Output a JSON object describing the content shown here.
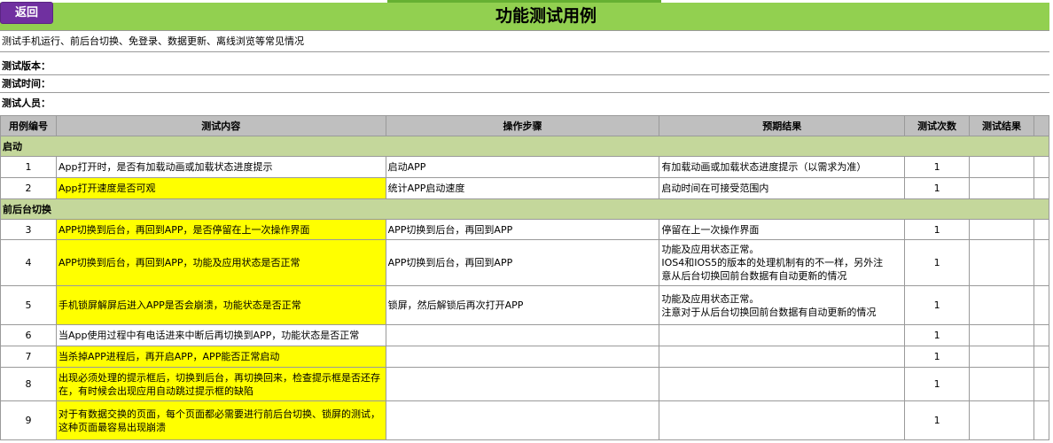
{
  "back_button": "返回",
  "title": "功能测试用例",
  "description": "测试手机运行、前后台切换、免登录、数据更新、离线浏览等常见情况",
  "meta": {
    "version_label": "测试版本：",
    "time_label": "测试时间：",
    "tester_label": "测试人员："
  },
  "columns": [
    "用例编号",
    "测试内容",
    "操作步骤",
    "预期结果",
    "测试次数",
    "测试结果"
  ],
  "sections": [
    {
      "title": "启动",
      "rows": [
        {
          "id": "1",
          "content": "App打开时，是否有加载动画或加载状态进度提示",
          "steps": "启动APP",
          "expected": [
            "有加载动画或加载状态进度提示（以需求为准）"
          ],
          "count": "1",
          "result": "",
          "highlight": false
        },
        {
          "id": "2",
          "content": "App打开速度是否可观",
          "steps": "统计APP启动速度",
          "expected": [
            "启动时间在可接受范围内"
          ],
          "count": "1",
          "result": "",
          "highlight": true
        }
      ]
    },
    {
      "title": "前后台切换",
      "rows": [
        {
          "id": "3",
          "content": "APP切换到后台，再回到APP，是否停留在上一次操作界面",
          "steps": "APP切换到后台，再回到APP",
          "expected": [
            "停留在上一次操作界面"
          ],
          "count": "1",
          "result": "",
          "highlight": true
        },
        {
          "id": "4",
          "content": "APP切换到后台，再回到APP，功能及应用状态是否正常",
          "steps": "APP切换到后台，再回到APP",
          "expected": [
            "功能及应用状态正常。",
            "IOS4和IOS5的版本的处理机制有的不一样，另外注",
            "意从后台切换回前台数据有自动更新的情况"
          ],
          "count": "1",
          "result": "",
          "highlight": true
        },
        {
          "id": "5",
          "content": "手机锁屏解屏后进入APP是否会崩溃，功能状态是否正常",
          "steps": "锁屏，然后解锁后再次打开APP",
          "expected": [
            "功能及应用状态正常。",
            "注意对于从后台切换回前台数据有自动更新的情况"
          ],
          "count": "1",
          "result": "",
          "highlight": true
        },
        {
          "id": "6",
          "content": "当App使用过程中有电话进来中断后再切换到APP，功能状态是否正常",
          "steps": "",
          "expected": [
            ""
          ],
          "count": "1",
          "result": "",
          "highlight": false
        },
        {
          "id": "7",
          "content": "当杀掉APP进程后，再开启APP，APP能否正常启动",
          "steps": "",
          "expected": [
            ""
          ],
          "count": "1",
          "result": "",
          "highlight": true
        },
        {
          "id": "8",
          "content": "出现必须处理的提示框后，切换到后台，再切换回来，检查提示框是否还存在，有时候会出现应用自动跳过提示框的缺陷",
          "steps": "",
          "expected": [
            ""
          ],
          "count": "1",
          "result": "",
          "highlight": true
        },
        {
          "id": "9",
          "content": "对于有数据交换的页面，每个页面都必需要进行前后台切换、锁屏的测试，这种页面最容易出现崩溃",
          "steps": "",
          "expected": [
            ""
          ],
          "count": "1",
          "result": "",
          "highlight": true
        }
      ]
    }
  ]
}
